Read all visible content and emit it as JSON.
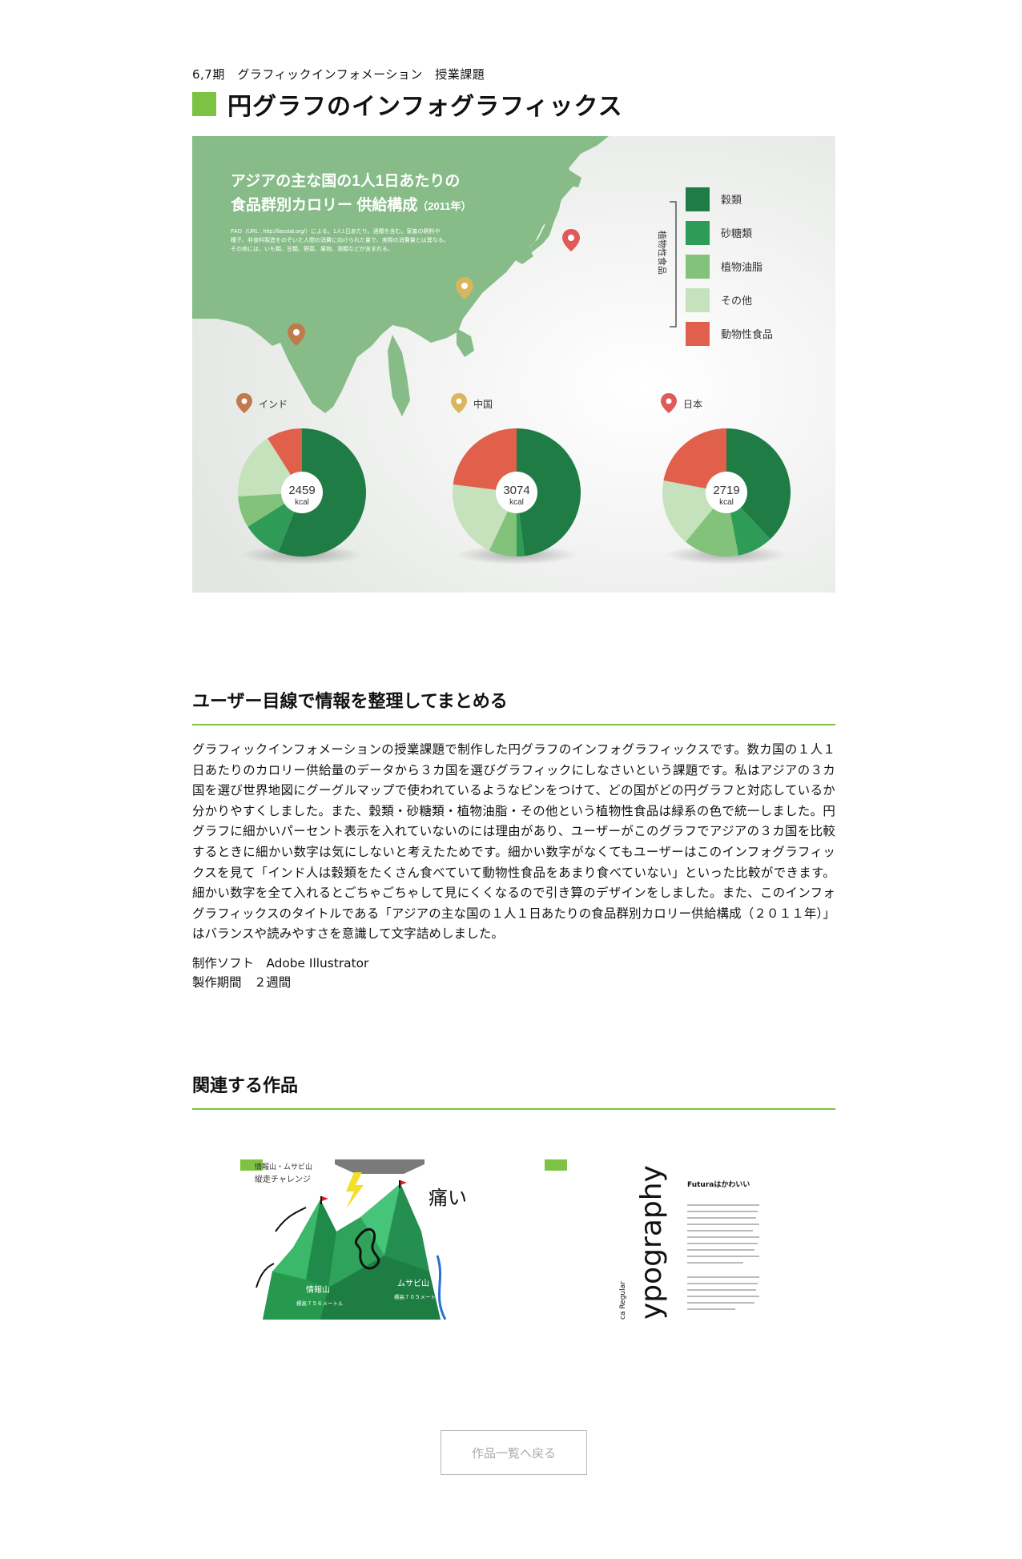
{
  "header": {
    "kicker": "6,7期　グラフィックインフォメーション　授業課題",
    "title": "円グラフのインフォグラフィックス"
  },
  "infographic": {
    "title_line1": "アジアの主な国の1人1日あたりの",
    "title_line2": "食品群別カロリー 供給構成",
    "title_year": "（2011年）",
    "note_line1": "FAO（URL : http://faostat.org/）による。1人1日あたり。酒類を含む。家畜の飼料や",
    "note_line2": "種子、非食料製造をのぞいた人間の消費に向けられた量で、実際の消費量とは異なる。",
    "note_line3": "その他には、いも類、豆類、野菜、果物、酒類などが含まれる。",
    "legend_group": "植物性食品",
    "legend": [
      {
        "label": "穀類",
        "color": "#1f7c45"
      },
      {
        "label": "砂糖類",
        "color": "#2e9c57"
      },
      {
        "label": "植物油脂",
        "color": "#82c27a"
      },
      {
        "label": "その他",
        "color": "#c5e2bd"
      },
      {
        "label": "動物性食品",
        "color": "#e0604b"
      }
    ],
    "pins": [
      {
        "name": "インド",
        "color": "#c07a4b"
      },
      {
        "name": "中国",
        "color": "#d9b55d"
      },
      {
        "name": "日本",
        "color": "#e05a5a"
      }
    ]
  },
  "chart_data": [
    {
      "type": "pie",
      "title": "インド",
      "center_value": "2459",
      "center_unit": "kcal",
      "categories": [
        "穀類",
        "砂糖類",
        "植物油脂",
        "その他",
        "動物性食品"
      ],
      "values": [
        56,
        10,
        8,
        17,
        9
      ]
    },
    {
      "type": "pie",
      "title": "中国",
      "center_value": "3074",
      "center_unit": "kcal",
      "categories": [
        "穀類",
        "砂糖類",
        "植物油脂",
        "その他",
        "動物性食品"
      ],
      "values": [
        48,
        2,
        7,
        20,
        23
      ]
    },
    {
      "type": "pie",
      "title": "日本",
      "center_value": "2719",
      "center_unit": "kcal",
      "categories": [
        "穀類",
        "砂糖類",
        "植物油脂",
        "その他",
        "動物性食品"
      ],
      "values": [
        38,
        9,
        14,
        17,
        22
      ]
    }
  ],
  "section1": {
    "heading": "ユーザー目線で情報を整理してまとめる",
    "body": "グラフィックインフォメーションの授業課題で制作した円グラフのインフォグラフィックスです。数カ国の１人１日あたりのカロリー供給量のデータから３カ国を選びグラフィックにしなさいという課題です。私はアジアの３カ国を選び世界地図にグーグルマップで使われているようなピンをつけて、どの国がどの円グラフと対応しているか分かりやすくしました。また、穀類・砂糖類・植物油脂・その他という植物性食品は緑系の色で統一しました。円グラフに細かいパーセント表示を入れていないのには理由があり、ユーザーがこのグラフでアジアの３カ国を比較するときに細かい数字は気にしないと考えたためです。細かい数字がなくてもユーザーはこのインフォグラフィックスを見て「インド人は穀類をたくさん食べていて動物性食品をあまり食べていない」といった比較ができます。細かい数字を全て入れるとごちゃごちゃして見にくくなるので引き算のデザインをしました。また、このインフォグラフィックスのタイトルである「アジアの主な国の１人１日あたりの食品群別カロリー供給構成（２０１１年）」はバランスや読みやすさを意識して文字詰めしました。",
    "software": "制作ソフト　Adobe Illustrator",
    "period": "製作期間　２週間"
  },
  "section2": {
    "heading": "関連する作品"
  },
  "related": [
    {
      "caption_line1": "情報山・ムサビ山",
      "caption_line2": "縦走チャレンジ",
      "exclaim": "痛い",
      "peak1": "情報山",
      "peak1_height": "標高７５６メートル",
      "peak2": "ムサビ山",
      "peak2_height": "標高７０５メートル"
    },
    {
      "big1": "phy",
      "big2": "ypography",
      "small_rot": "ca Regular",
      "heading": "Futuraはかわいい"
    }
  ],
  "back_button": "作品一覧へ戻る"
}
